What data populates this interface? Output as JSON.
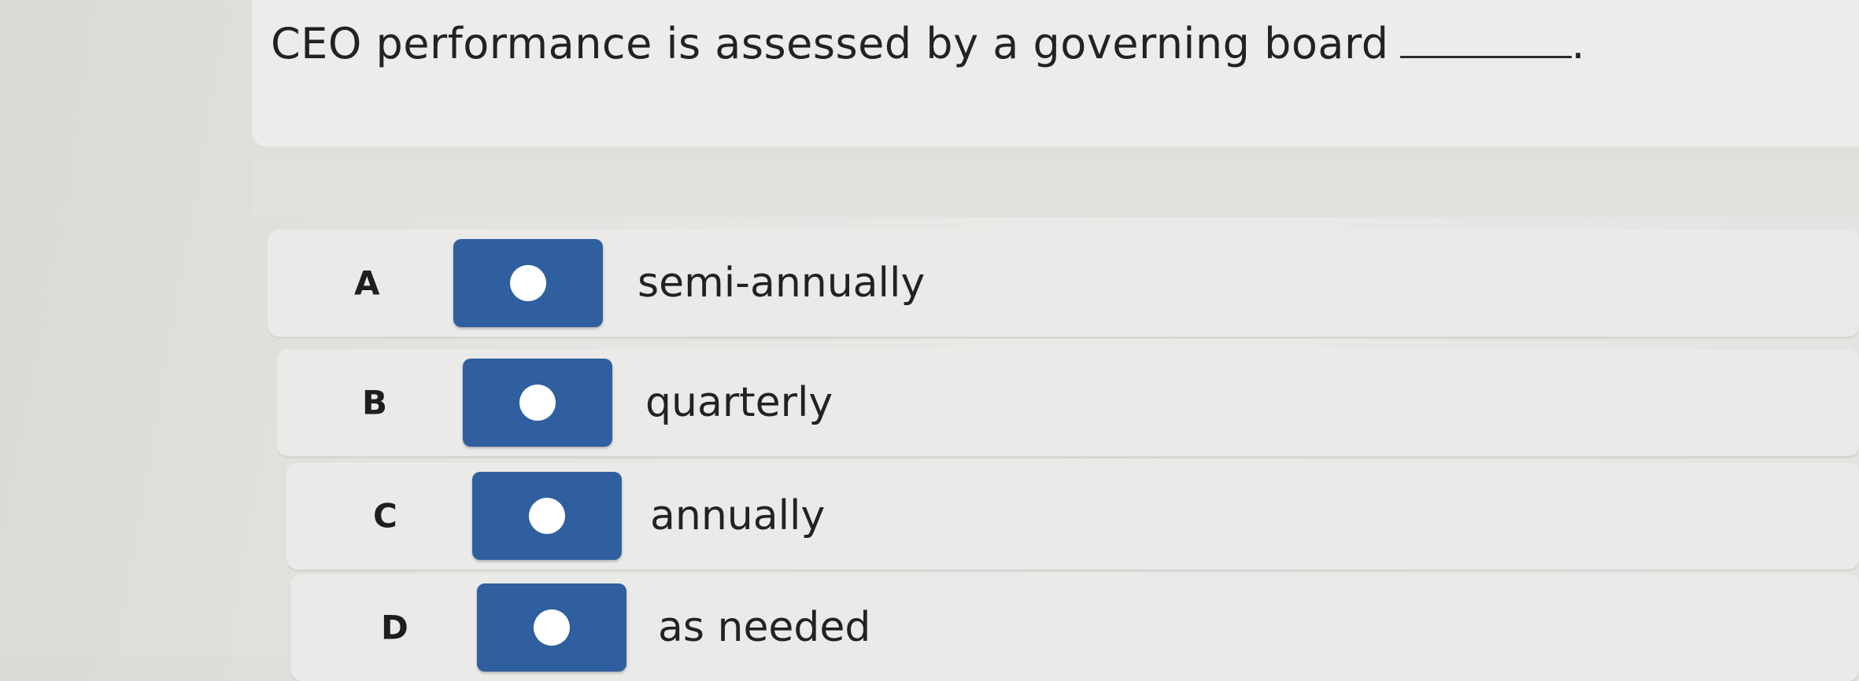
{
  "question": {
    "text": "CEO performance is assessed by a governing board",
    "suffix": "."
  },
  "options": [
    {
      "letter": "A",
      "label": "semi-annually"
    },
    {
      "letter": "B",
      "label": "quarterly"
    },
    {
      "letter": "C",
      "label": "annually"
    },
    {
      "letter": "D",
      "label": "as needed"
    }
  ],
  "colors": {
    "radio_fill": "#2f5f9e",
    "radio_dot": "#ffffff"
  }
}
